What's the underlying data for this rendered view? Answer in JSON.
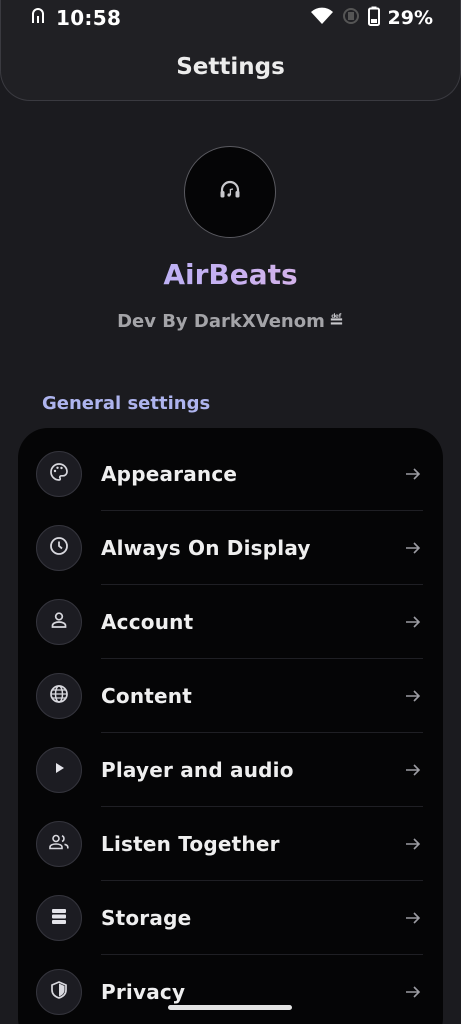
{
  "status_bar": {
    "time": "10:58",
    "battery": "29%",
    "icons": [
      "notification-icon",
      "wifi-icon",
      "battery-saver-icon",
      "battery-icon"
    ]
  },
  "app_bar": {
    "title": "Settings"
  },
  "profile": {
    "avatar_icon": "headphones-icon",
    "app_name": "AirBeats",
    "dev_by": "Dev By DarkXVenom",
    "dev_glyph": "≝"
  },
  "general": {
    "section_title": "General settings",
    "items": [
      {
        "label": "Appearance",
        "icon": "palette-icon"
      },
      {
        "label": "Always On Display",
        "icon": "clock-icon"
      },
      {
        "label": "Account",
        "icon": "person-icon"
      },
      {
        "label": "Content",
        "icon": "globe-icon"
      },
      {
        "label": "Player and audio",
        "icon": "play-icon"
      },
      {
        "label": "Listen Together",
        "icon": "group-icon"
      },
      {
        "label": "Storage",
        "icon": "storage-icon"
      },
      {
        "label": "Privacy",
        "icon": "shield-icon"
      }
    ]
  },
  "colors": {
    "accent": "#aeb4ee",
    "background": "#1b1b1f",
    "card": "#050506",
    "gradient_start": "#a6b2ff",
    "gradient_end": "#f0b6dc"
  }
}
